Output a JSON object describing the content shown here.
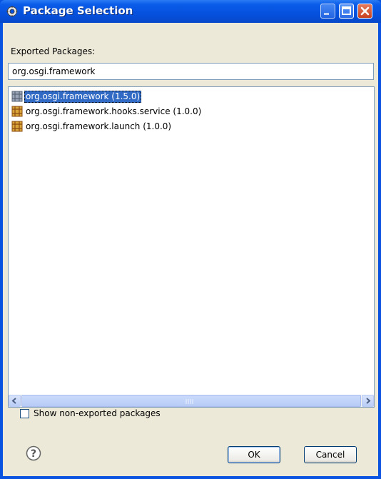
{
  "window": {
    "title": "Package Selection"
  },
  "filter": {
    "label": "Exported Packages:",
    "value": "org.osgi.framework"
  },
  "packages": [
    {
      "label": "org.osgi.framework (1.5.0)",
      "selected": true
    },
    {
      "label": "org.osgi.framework.hooks.service (1.0.0)",
      "selected": false
    },
    {
      "label": "org.osgi.framework.launch (1.0.0)",
      "selected": false
    }
  ],
  "options": {
    "show_non_exported_label": "Show non-exported packages",
    "show_non_exported_checked": false
  },
  "buttons": {
    "ok": "OK",
    "cancel": "Cancel"
  },
  "icons": {
    "title": "gear-icon",
    "package": "package-icon",
    "help": "help-icon"
  },
  "colors": {
    "titlebar": "#0551DE",
    "selection": "#316AC5",
    "dialog_bg": "#ECE9D8"
  }
}
